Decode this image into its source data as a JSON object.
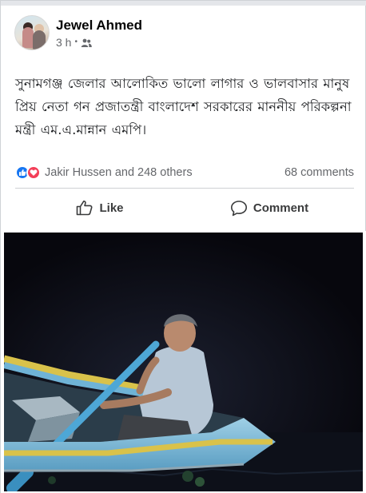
{
  "post": {
    "author": "Jewel Ahmed",
    "time": "3 h",
    "separator": "•",
    "audience_icon": "friends-icon",
    "message": "সুনামগঞ্জ জেলার আলোকিত ভালো লাগার ও ভালবাসার মানুষ প্রিয় নেতা গন প্রজাতন্ত্রী বাংলাদেশ সরকারের মাননীয় পরিকল্পনা মন্ত্রী  এম.এ.মান্নান এমপি।"
  },
  "reactions": {
    "icons": [
      "like-icon",
      "love-icon"
    ],
    "summary": "Jakir Hussen and 248 others",
    "comments": "68 comments"
  },
  "actions": {
    "like": "Like",
    "comment": "Comment"
  },
  "colors": {
    "like_blue": "#1877f2",
    "love_red": "#f33e58",
    "secondary_text": "#65676b",
    "photo_background": "#0b0b14",
    "boat_blue": "#6fb3d6",
    "boat_yellow": "#d9c24a"
  },
  "photo": {
    "subject": "man rowing a wooden boat at night"
  }
}
